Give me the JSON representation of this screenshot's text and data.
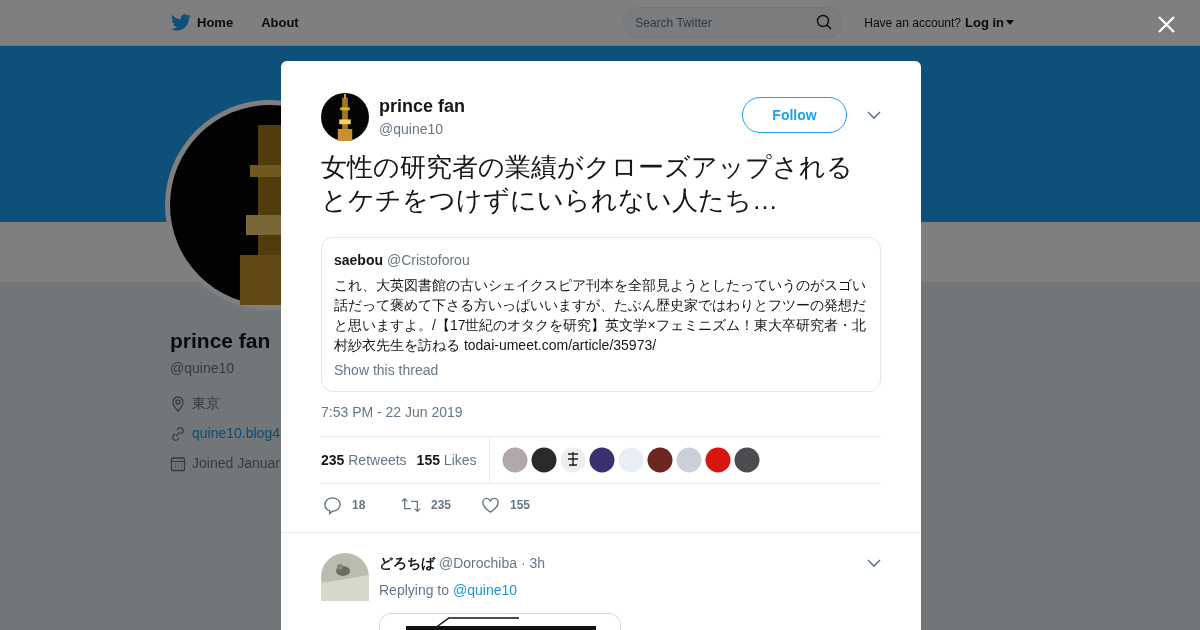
{
  "nav": {
    "links": [
      "Home",
      "About"
    ],
    "search": {
      "placeholder": "Search Twitter"
    },
    "account_prompt": "Have an account?",
    "login": "Log in"
  },
  "profile": {
    "name": "prince fan",
    "handle": "@quine10",
    "location": "東京",
    "link": "quine10.blog4",
    "joined": "Joined Januar"
  },
  "tweet": {
    "name": "prince fan",
    "handle": "@quine10",
    "follow": "Follow",
    "text": "女性の研究者の業績がクローズアップされるとケチをつけずにいられない人たち…",
    "quote": {
      "name": "saebou",
      "handle": "@Cristoforou",
      "text": "これ、大英図書館の古いシェイクスピア刊本を全部見ようとしたっていうのがスゴい話だって褒めて下さる方いっぱいいますが、たぶん歴史家ではわりとフツーの発想だと思いますよ。/【17世紀のオタクを研究】英文学×フェミニズム！東大卒研究者・北村紗衣先生を訪ねる",
      "link": "todai-umeet.com/article/35973/",
      "thread": "Show this thread"
    },
    "time": "7:53 PM - 22 Jun 2019",
    "stats": [
      {
        "count": "235",
        "label": "Retweets"
      },
      {
        "count": "155",
        "label": "Likes"
      }
    ],
    "likers": [
      {
        "color": "#b0a8ac"
      },
      {
        "color": "#2a2a2a"
      },
      {
        "color": "#eeeeee"
      },
      {
        "color": "#3b2f6e"
      },
      {
        "color": "#e8eef4"
      },
      {
        "color": "#6b2620"
      },
      {
        "color": "#c9d0d8"
      },
      {
        "color": "#d9150f"
      },
      {
        "color": "#4a4c50"
      }
    ],
    "actions": [
      {
        "kind": "reply",
        "count": "18"
      },
      {
        "kind": "retweet",
        "count": "235"
      },
      {
        "kind": "like",
        "count": "155"
      }
    ]
  },
  "reply": {
    "name": "どろちば",
    "handle": "@Dorochiba",
    "age": "· 3h",
    "replying_to": "Replying to",
    "mention": "@quine10"
  }
}
